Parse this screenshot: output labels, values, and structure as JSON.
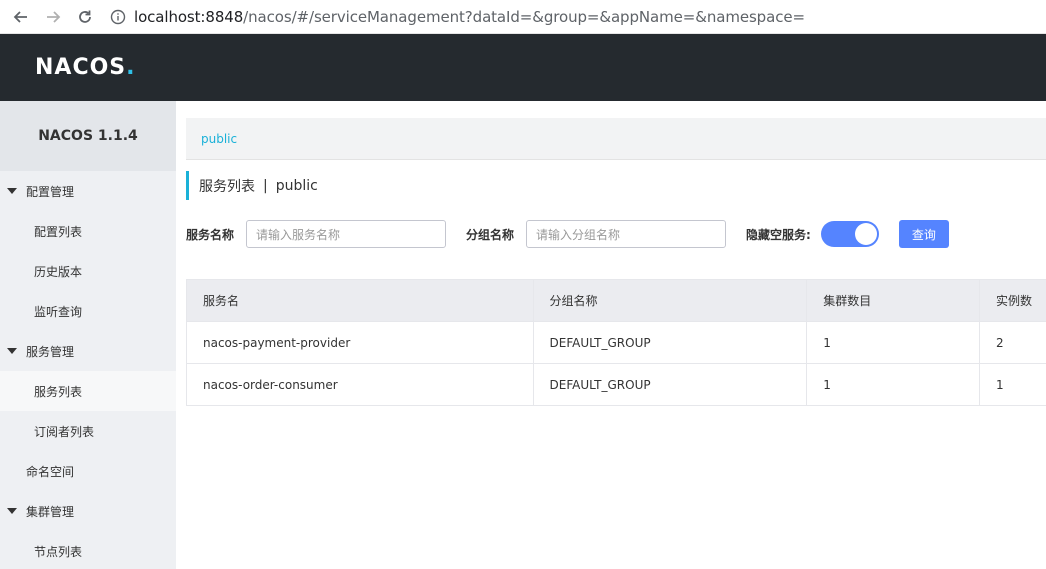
{
  "browser": {
    "url_host": "localhost:8848",
    "url_path": "/nacos/#/serviceManagement?dataId=&group=&appName=&namespace="
  },
  "header": {
    "logo_text": "NACOS",
    "logo_dot": "."
  },
  "sidebar": {
    "version": "NACOS 1.1.4",
    "groups": [
      {
        "label": "配置管理",
        "items": [
          "配置列表",
          "历史版本",
          "监听查询"
        ]
      },
      {
        "label": "服务管理",
        "items": [
          "服务列表",
          "订阅者列表"
        ]
      },
      {
        "plain": "命名空间"
      },
      {
        "label": "集群管理",
        "items": [
          "节点列表"
        ]
      }
    ],
    "active_item": "服务列表"
  },
  "breadcrumb": {
    "namespace": "public"
  },
  "page": {
    "title": "服务列表",
    "separator": "|",
    "namespace": "public"
  },
  "filters": {
    "service_name_label": "服务名称",
    "service_name_placeholder": "请输入服务名称",
    "group_name_label": "分组名称",
    "group_name_placeholder": "请输入分组名称",
    "hide_empty_label": "隐藏空服务:",
    "hide_empty_on": true,
    "query_label": "查询"
  },
  "table": {
    "columns": [
      "服务名",
      "分组名称",
      "集群数目",
      "实例数"
    ],
    "rows": [
      [
        "nacos-payment-provider",
        "DEFAULT_GROUP",
        "1",
        "2"
      ],
      [
        "nacos-order-consumer",
        "DEFAULT_GROUP",
        "1",
        "1"
      ]
    ]
  },
  "colors": {
    "header_bg": "#252a2f",
    "accent": "#1ab1d8",
    "primary_button": "#5584ff"
  }
}
